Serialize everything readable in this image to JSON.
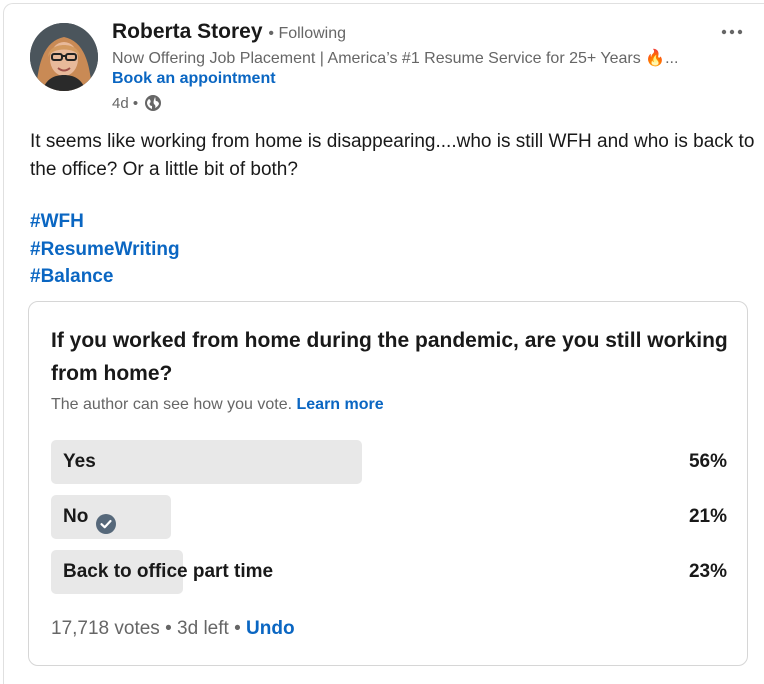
{
  "author": {
    "name": "Roberta Storey",
    "relationship": "• Following",
    "headline": "Now Offering Job Placement | America’s #1 Resume Service for 25+ Years 🔥...",
    "action_link": "Book an appointment",
    "post_age": "4d •"
  },
  "post": {
    "text": "It seems like working from home is disappearing....who is still WFH and who is back to the office? Or a little bit of both?",
    "hashtags": [
      "#WFH",
      "#ResumeWriting",
      "#Balance"
    ]
  },
  "poll": {
    "question": "If you worked from home during the pandemic, are you still working from home?",
    "note": "The author can see how you vote.",
    "learn_more": "Learn more",
    "options": [
      {
        "label": "Yes",
        "percent": "56%",
        "fraction": 0.46,
        "selected": false
      },
      {
        "label": "No",
        "percent": "21%",
        "fraction": 0.177,
        "selected": true
      },
      {
        "label": "Back to office part time",
        "percent": "23%",
        "fraction": 0.195,
        "selected": false
      }
    ],
    "votes": "17,718 votes",
    "time_left": "3d left",
    "undo": "Undo"
  },
  "icons": {
    "more": "ellipsis-icon",
    "visibility": "globe-icon",
    "selected": "checkmark-circle-icon"
  },
  "colors": {
    "link": "#0a66c2",
    "text": "#191919",
    "muted": "#666666",
    "bar": "#e8e8e8"
  }
}
